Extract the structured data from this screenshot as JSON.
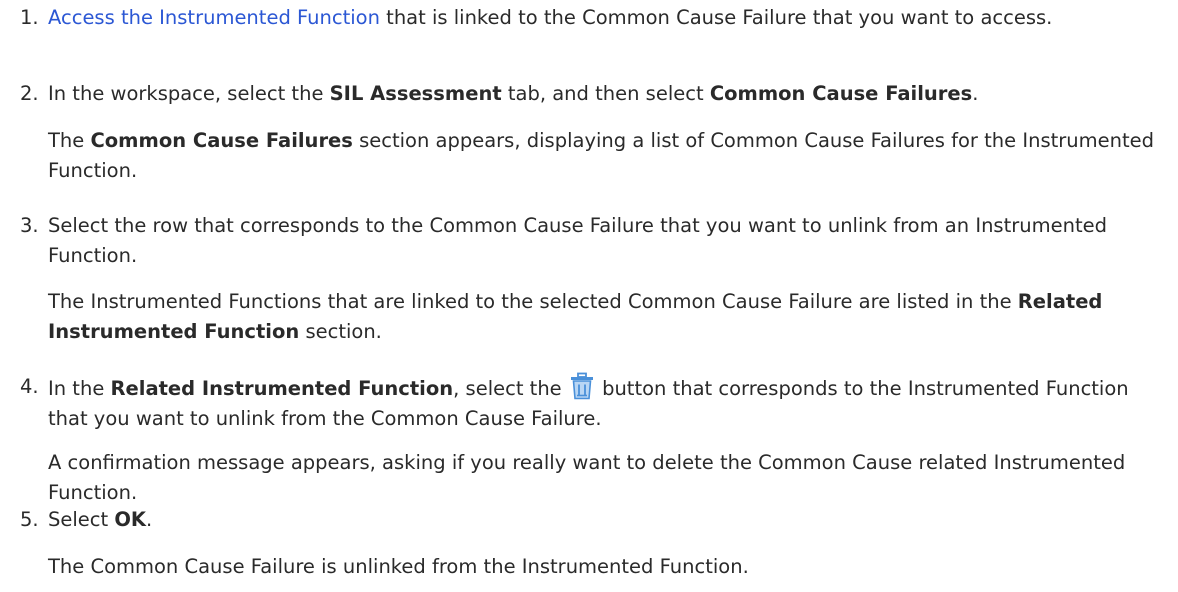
{
  "steps": [
    {
      "number": "1.",
      "link_text": "Access the Instrumented Function",
      "text_rest": " that is linked to the Common Cause Failure that you want to access."
    },
    {
      "number": "2.",
      "text_a": "In the workspace, select the ",
      "bold_a": "SIL Assessment",
      "text_b": " tab, and then select ",
      "bold_b": "Common Cause Failures",
      "text_c": ".",
      "result_a": "The ",
      "result_bold": "Common Cause Failures",
      "result_b": " section appears, displaying a list of Common Cause Failures for the Instrumented Function."
    },
    {
      "number": "3.",
      "text": "Select the row that corresponds to the Common Cause Failure that you want to unlink from an Instrumented Function.",
      "result_a": "The Instrumented Functions that are linked to the selected Common Cause Failure are listed in the ",
      "result_bold": "Related Instrumented Function",
      "result_b": " section."
    },
    {
      "number": "4.",
      "text_a": "In the ",
      "bold_a": "Related Instrumented Function",
      "text_b": ", select the ",
      "icon": "trash-icon",
      "text_c": " button that corresponds to the Instrumented Function that you want to unlink from the Common Cause Failure.",
      "result": "A confirmation message appears, asking if you really want to delete the Common Cause related Instrumented Function."
    },
    {
      "number": "5.",
      "text_a": "Select ",
      "bold_a": "OK",
      "text_b": ".",
      "result": "The Common Cause Failure is unlinked from the Instrumented Function."
    }
  ],
  "colors": {
    "link": "#2b57d4",
    "text": "#2a2a2a",
    "icon": "#4a90d9"
  }
}
